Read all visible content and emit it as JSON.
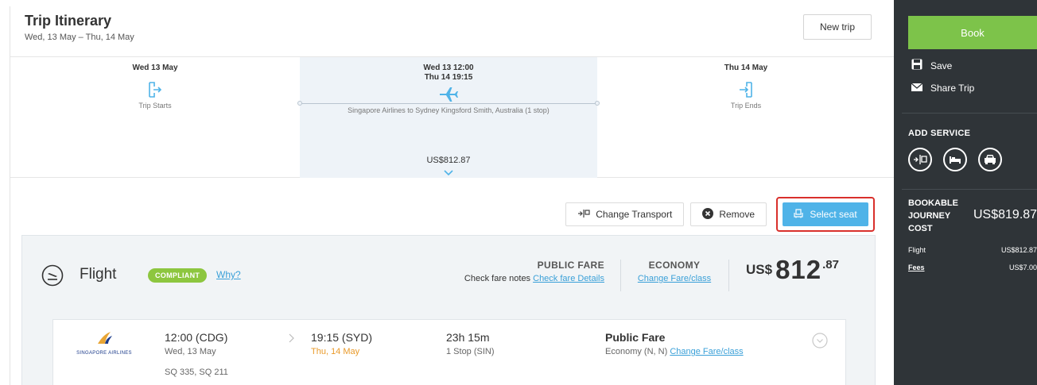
{
  "header": {
    "title": "Trip Itinerary",
    "dates": "Wed, 13 May – Thu, 14 May",
    "new_trip_label": "New trip"
  },
  "timeline": {
    "start": {
      "date": "Wed 13 May",
      "label": "Trip Starts"
    },
    "transport": {
      "depart": "Wed 13  12:00",
      "arrive": "Thu 14  19:15",
      "description": "Singapore Airlines to Sydney Kingsford Smith, Australia (1 stop)",
      "price": "US$812.87"
    },
    "end": {
      "date": "Thu 14 May",
      "label": "Trip Ends"
    }
  },
  "actions": {
    "change_transport": "Change Transport",
    "remove": "Remove",
    "select_seat": "Select seat"
  },
  "flight": {
    "title": "Flight",
    "badge": "COMPLIANT",
    "why_link": "Why?",
    "fare_type": "PUBLIC FARE",
    "fare_notes_prefix": "Check fare notes",
    "fare_notes_link": "Check fare Details",
    "cabin": "ECONOMY",
    "change_fare_link": "Change Fare/class",
    "price_currency": "US$",
    "price_int": "812",
    "price_dec": ".87",
    "segment": {
      "airline": "SINGAPORE AIRLINES",
      "depart_time": "12:00 (CDG)",
      "depart_date": "Wed, 13 May",
      "flight_numbers": "SQ 335, SQ 211",
      "arrive_time": "19:15 (SYD)",
      "arrive_date": "Thu, 14 May",
      "duration": "23h 15m",
      "stops": "1 Stop (SIN)",
      "fare_title": "Public Fare",
      "fare_class_prefix": "Economy (N, N)",
      "fare_class_link": "Change Fare/class"
    }
  },
  "sidebar": {
    "book_label": "Book",
    "save_label": "Save",
    "share_label": "Share Trip",
    "add_service_heading": "ADD SERVICE",
    "cost_label_1": "BOOKABLE",
    "cost_label_2": "JOURNEY",
    "cost_label_3": "COST",
    "cost_value": "US$819.87",
    "flight_label": "Flight",
    "flight_value": "US$812.87",
    "fees_label": "Fees",
    "fees_value": "US$7.00"
  },
  "colors": {
    "accent_blue": "#4fb3e8",
    "book_green": "#7dc34a",
    "compliant_green": "#8dc63f",
    "highlight_red": "#d9302c",
    "sidebar_bg": "#2f3438"
  }
}
